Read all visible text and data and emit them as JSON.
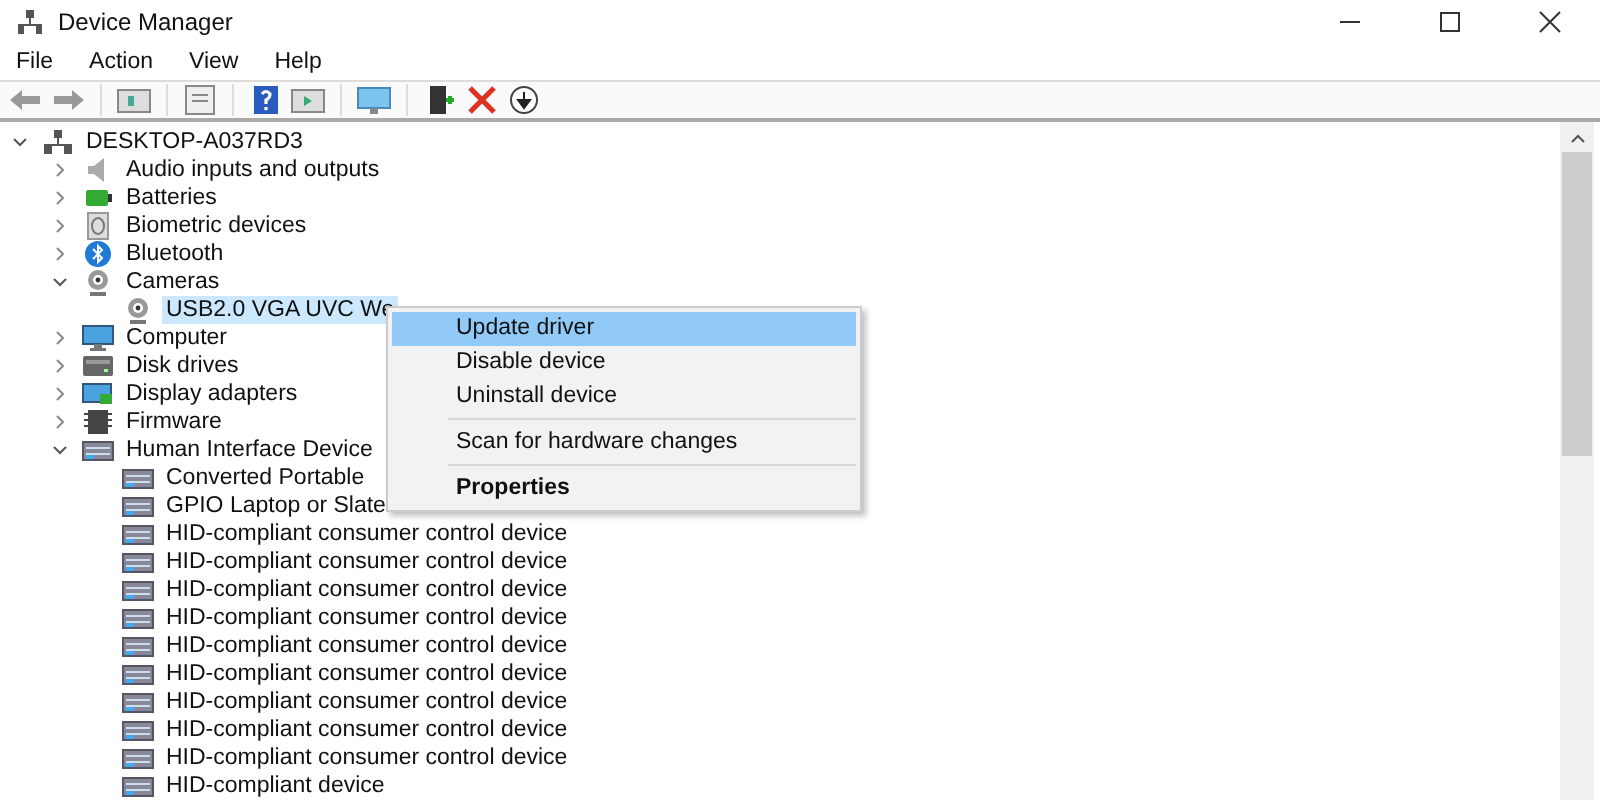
{
  "window": {
    "title": "Device Manager"
  },
  "menu_bar": [
    "File",
    "Action",
    "View",
    "Help"
  ],
  "toolbar": [
    {
      "kind": "back"
    },
    {
      "kind": "forward"
    },
    {
      "kind": "sep"
    },
    {
      "kind": "tree"
    },
    {
      "kind": "sep"
    },
    {
      "kind": "props"
    },
    {
      "kind": "sep"
    },
    {
      "kind": "help"
    },
    {
      "kind": "pane"
    },
    {
      "kind": "sep"
    },
    {
      "kind": "monitor"
    },
    {
      "kind": "sep"
    },
    {
      "kind": "add"
    },
    {
      "kind": "remove"
    },
    {
      "kind": "download"
    }
  ],
  "tree": [
    {
      "label": "DESKTOP-A037RD3",
      "kind": "computer",
      "expanded": true,
      "selected": false,
      "children": [
        {
          "label": "Audio inputs and outputs",
          "kind": "speaker",
          "expanded": false,
          "selected": false
        },
        {
          "label": "Batteries",
          "kind": "battery",
          "expanded": false,
          "selected": false
        },
        {
          "label": "Biometric devices",
          "kind": "biometric",
          "expanded": false,
          "selected": false
        },
        {
          "label": "Bluetooth",
          "kind": "bluetooth",
          "expanded": false,
          "selected": false
        },
        {
          "label": "Cameras",
          "kind": "camera",
          "expanded": true,
          "selected": false,
          "children": [
            {
              "label": "USB2.0 VGA UVC We",
              "kind": "camera",
              "selected": true
            }
          ]
        },
        {
          "label": "Computer",
          "kind": "monitor",
          "expanded": false,
          "selected": false
        },
        {
          "label": "Disk drives",
          "kind": "disk",
          "expanded": false,
          "selected": false
        },
        {
          "label": "Display adapters",
          "kind": "display",
          "expanded": false,
          "selected": false
        },
        {
          "label": "Firmware",
          "kind": "chip",
          "expanded": false,
          "selected": false
        },
        {
          "label": "Human Interface Device",
          "kind": "hid",
          "expanded": true,
          "selected": false,
          "children": [
            {
              "label": "Converted Portable",
              "kind": "hid",
              "selected": false
            },
            {
              "label": "GPIO Laptop or Slate",
              "kind": "hid",
              "selected": false
            },
            {
              "label": "HID-compliant consumer control device",
              "kind": "hid",
              "selected": false
            },
            {
              "label": "HID-compliant consumer control device",
              "kind": "hid",
              "selected": false
            },
            {
              "label": "HID-compliant consumer control device",
              "kind": "hid",
              "selected": false
            },
            {
              "label": "HID-compliant consumer control device",
              "kind": "hid",
              "selected": false
            },
            {
              "label": "HID-compliant consumer control device",
              "kind": "hid",
              "selected": false
            },
            {
              "label": "HID-compliant consumer control device",
              "kind": "hid",
              "selected": false
            },
            {
              "label": "HID-compliant consumer control device",
              "kind": "hid",
              "selected": false
            },
            {
              "label": "HID-compliant consumer control device",
              "kind": "hid",
              "selected": false
            },
            {
              "label": "HID-compliant consumer control device",
              "kind": "hid",
              "selected": false
            },
            {
              "label": "HID-compliant device",
              "kind": "hid",
              "selected": false
            }
          ]
        }
      ]
    }
  ],
  "context_menu": [
    {
      "label": "Update driver",
      "selected": true,
      "separator_before": false,
      "default": false
    },
    {
      "label": "Disable device",
      "selected": false,
      "separator_before": false,
      "default": false
    },
    {
      "label": "Uninstall device",
      "selected": false,
      "separator_before": false,
      "default": false
    },
    {
      "label": "Scan for hardware changes",
      "selected": false,
      "separator_before": true,
      "default": false
    },
    {
      "label": "Properties",
      "selected": false,
      "separator_before": true,
      "default": true
    }
  ]
}
